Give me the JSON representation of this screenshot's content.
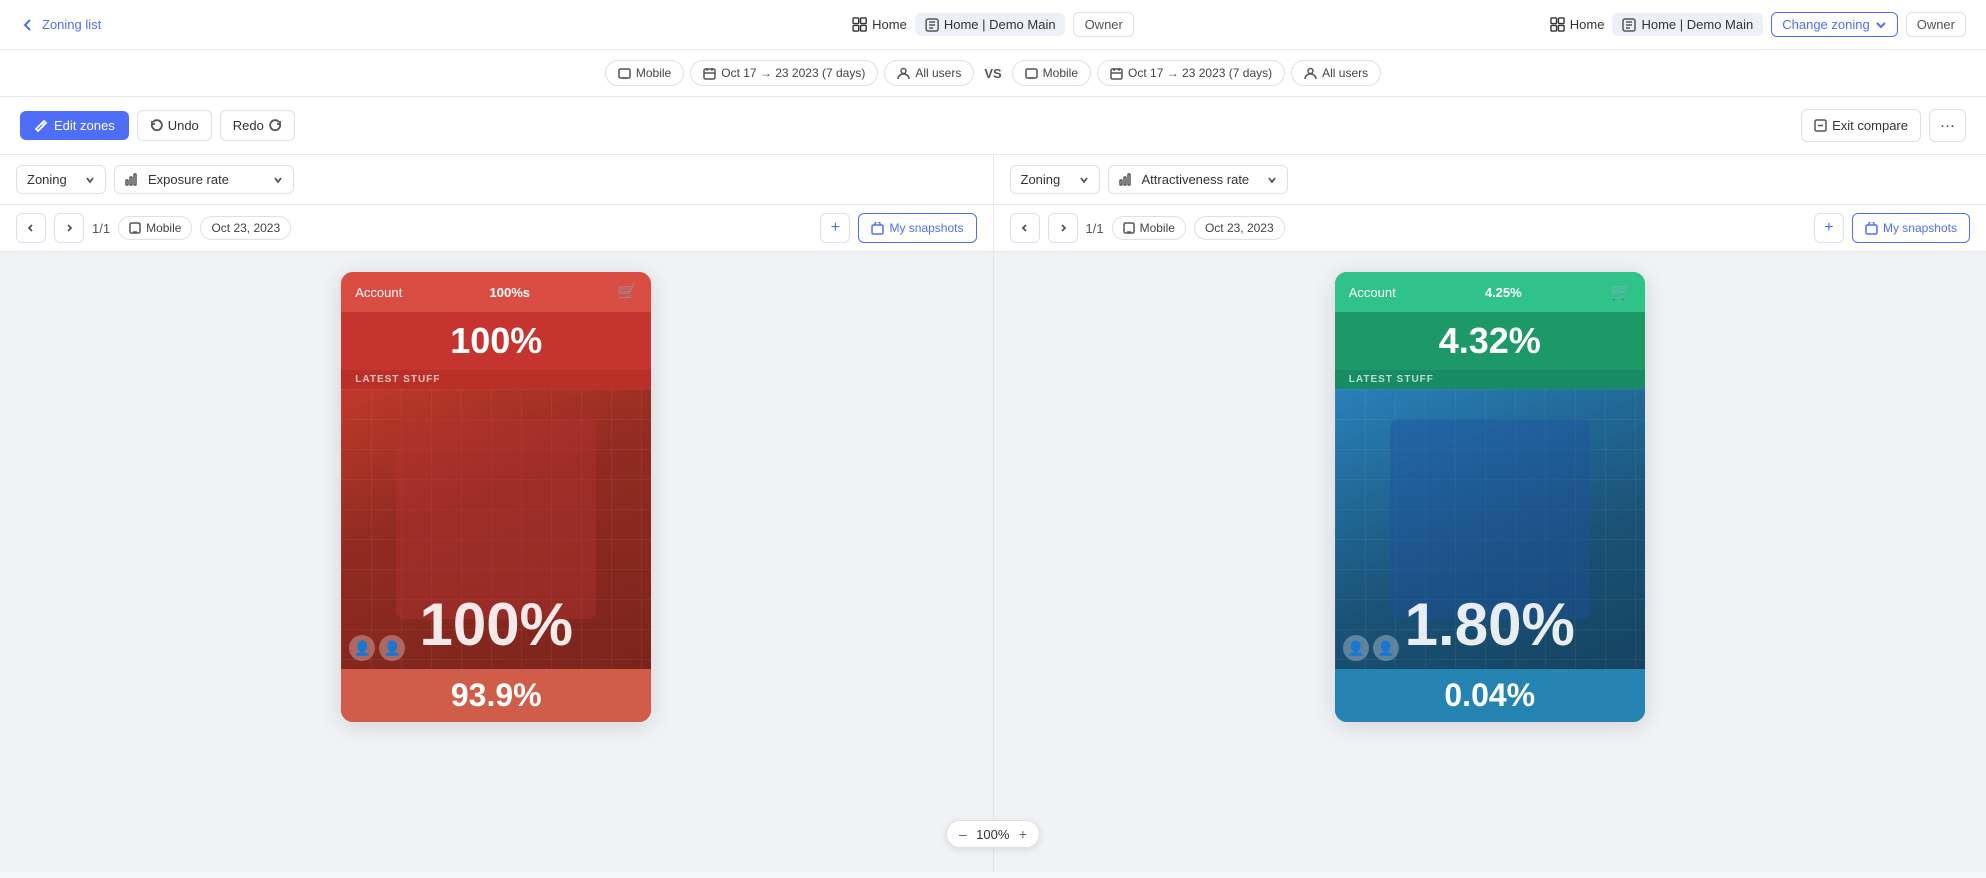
{
  "nav_left": {
    "back_label": "Zoning list"
  },
  "nav_center": {
    "home_label": "Home",
    "breadcrumb_label": "Home | Demo Main",
    "owner_label": "Owner"
  },
  "nav_right": {
    "home_label": "Home",
    "breadcrumb_label": "Home | Demo Main",
    "change_zoning_label": "Change zoning",
    "owner_label": "Owner"
  },
  "filter_bar": {
    "left": {
      "device": "Mobile",
      "date_range": "Oct 17 → 23 2023 (7 days)",
      "users": "All users"
    },
    "vs_label": "VS",
    "right": {
      "device": "Mobile",
      "date_range": "Oct 17 → 23 2023 (7 days)",
      "users": "All users"
    }
  },
  "toolbar": {
    "edit_zones_label": "Edit zones",
    "undo_label": "Undo",
    "redo_label": "Redo",
    "exit_compare_label": "Exit compare",
    "more_label": "···"
  },
  "left_panel": {
    "zoning_label": "Zoning",
    "metric_label": "Exposure rate",
    "nav_prev": "←",
    "nav_next": "→",
    "page_indicator": "1/1",
    "device": "Mobile",
    "date": "Oct 23, 2023",
    "add_label": "+",
    "snapshots_label": "My snapshots",
    "zones": {
      "account_name": "Account",
      "account_pct_small": "100%s",
      "account_pct_big": "100%",
      "latest_label": "LATEST STUFF",
      "main_pct": "100%",
      "bottom_pct": "93.9%"
    }
  },
  "right_panel": {
    "zoning_label": "Zoning",
    "metric_label": "Attractiveness rate",
    "nav_prev": "←",
    "nav_next": "→",
    "page_indicator": "1/1",
    "device": "Mobile",
    "date": "Oct 23, 2023",
    "add_label": "+",
    "snapshots_label": "My snapshots",
    "zones": {
      "account_name": "Account",
      "account_pct_small": "4.25%",
      "account_pct_big": "4.32%",
      "latest_label": "LATEST STUFF",
      "main_pct": "1.80%",
      "bottom_pct": "0.04%"
    }
  },
  "zoom": {
    "value": "100%",
    "zoom_in": "+",
    "zoom_out": "–"
  }
}
